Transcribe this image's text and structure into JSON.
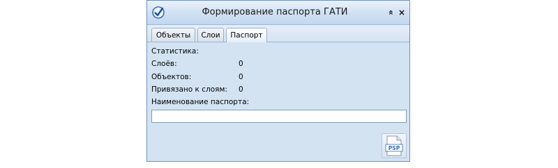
{
  "window": {
    "title": "Формирование паспорта ГАТИ",
    "collapse_glyph": "»",
    "close_glyph": "×"
  },
  "tabs": [
    {
      "label": "Объекты",
      "active": false
    },
    {
      "label": "Слои",
      "active": false
    },
    {
      "label": "Паспорт",
      "active": true
    }
  ],
  "stats": {
    "header": "Статистика:",
    "layers_label": "Слоёв:",
    "layers_value": "0",
    "objects_label": "Объектов:",
    "objects_value": "0",
    "bound_label": "Привязано к слоям:",
    "bound_value": "0"
  },
  "passport_name": {
    "label": "Наименование паспорта:",
    "value": ""
  },
  "pdf_button": {
    "icon": "pdf-file-icon",
    "text": "PSP"
  },
  "colors": {
    "accent": "#3a6fb0",
    "panel_bg": "#d3e3f2",
    "pdf_red": "#c0392b"
  }
}
